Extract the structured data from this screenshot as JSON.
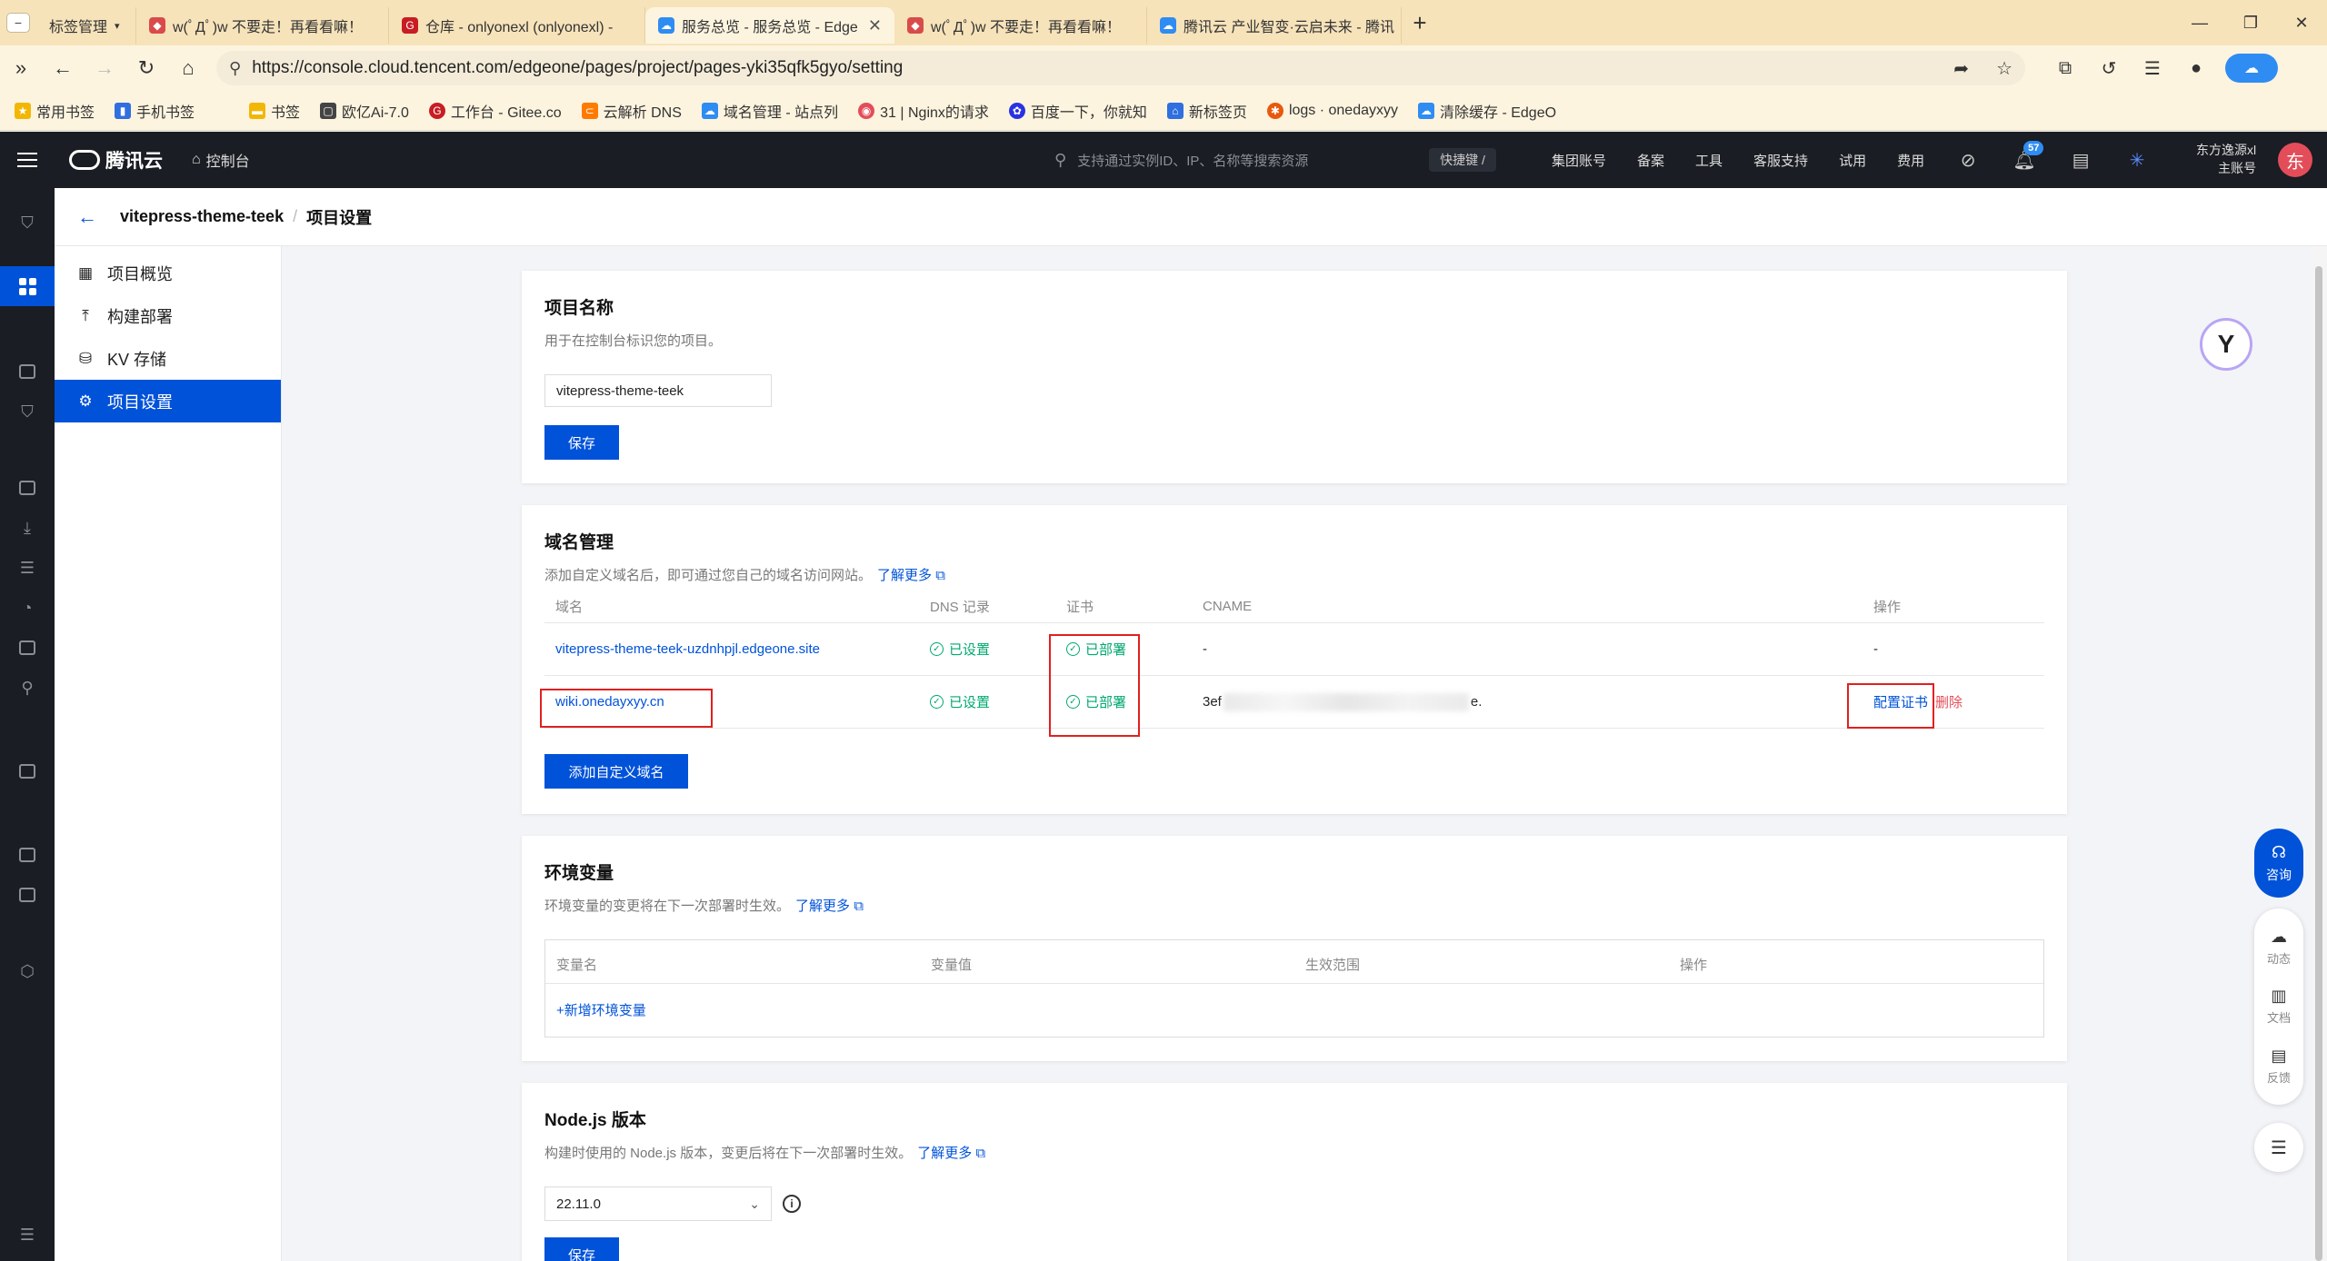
{
  "browser": {
    "tabs": [
      {
        "title": "标签管理",
        "color": "#555",
        "active": false
      },
      {
        "title": "w(ﾟДﾟ)w 不要走！再看看嘛！",
        "color": "#d94b4b",
        "active": false
      },
      {
        "title": "仓库 - onlyonexl (onlyonexl) - ",
        "color": "#c71d23",
        "active": false
      },
      {
        "title": "服务总览 - 服务总览 - EdgeO",
        "color": "#2f8cf2",
        "active": true
      },
      {
        "title": "w(ﾟДﾟ)w 不要走！再看看嘛！",
        "color": "#d94b4b",
        "active": false
      },
      {
        "title": "腾讯云 产业智变·云启未来 - 腾讯",
        "color": "#2f8cf2",
        "active": false
      }
    ],
    "url": "https://console.cloud.tencent.com/edgeone/pages/project/pages-yki35qfk5gyo/setting",
    "bookmarks": [
      {
        "label": "常用书签",
        "color": "#f2b705"
      },
      {
        "label": "手机书签",
        "color": "#2f6fe0"
      },
      {
        "label": "书签",
        "color": "#f2b705"
      },
      {
        "label": "欧亿Ai-7.0",
        "color": "#444"
      },
      {
        "label": "工作台 - Gitee.co",
        "color": "#c71d23"
      },
      {
        "label": "云解析 DNS",
        "color": "#ff7a00"
      },
      {
        "label": "域名管理 - 站点列",
        "color": "#2f8cf2"
      },
      {
        "label": "31 | Nginx的请求",
        "color": "#e34d59"
      },
      {
        "label": "百度一下，你就知",
        "color": "#2932e1"
      },
      {
        "label": "新标签页",
        "color": "#2f6fe0"
      },
      {
        "label": "logs · onedayxyy",
        "color": "#e8590c"
      },
      {
        "label": "清除缓存 - EdgeO",
        "color": "#2f8cf2"
      }
    ]
  },
  "topnav": {
    "brand": "腾讯云",
    "console": "控制台",
    "search_placeholder": "支持通过实例ID、IP、名称等搜索资源",
    "shortcut": "快捷键 /",
    "items": [
      "集团账号",
      "备案",
      "工具",
      "客服支持",
      "试用",
      "费用"
    ],
    "badge": "57",
    "account_name": "东方逸源xl",
    "account_role": "主账号",
    "avatar": "东"
  },
  "breadcrumb": {
    "project": "vitepress-theme-teek",
    "page": "项目设置"
  },
  "sidemenu": {
    "items": [
      {
        "label": "项目概览",
        "icon": "overview-icon",
        "active": false
      },
      {
        "label": "构建部署",
        "icon": "deploy-icon",
        "active": false
      },
      {
        "label": "KV 存储",
        "icon": "database-icon",
        "active": false
      },
      {
        "label": "项目设置",
        "icon": "settings-icon",
        "active": true
      }
    ]
  },
  "project_name": {
    "title": "项目名称",
    "desc": "用于在控制台标识您的项目。",
    "value": "vitepress-theme-teek",
    "save": "保存"
  },
  "domains": {
    "title": "域名管理",
    "desc": "添加自定义域名后，即可通过您自己的域名访问网站。",
    "learn_more": "了解更多",
    "headers": {
      "domain": "域名",
      "dns": "DNS 记录",
      "cert": "证书",
      "cname": "CNAME",
      "ops": "操作"
    },
    "rows": [
      {
        "domain": "vitepress-theme-teek-uzdnhpjl.edgeone.site",
        "dns": "已设置",
        "cert": "已部署",
        "cname_start": "-",
        "cname_end": "",
        "op1": "-",
        "op2": ""
      },
      {
        "domain": "wiki.onedayxyy.cn",
        "dns": "已设置",
        "cert": "已部署",
        "cname_start": "3ef",
        "cname_end": "e.",
        "op1": "配置证书",
        "op2": "删除"
      }
    ],
    "add": "添加自定义域名"
  },
  "env": {
    "title": "环境变量",
    "desc": "环境变量的变更将在下一次部署时生效。",
    "learn_more": "了解更多",
    "headers": {
      "name": "变量名",
      "value": "变量值",
      "scope": "生效范围",
      "ops": "操作"
    },
    "add": "+新增环境变量"
  },
  "node": {
    "title": "Node.js 版本",
    "desc": "构建时使用的 Node.js 版本，变更后将在下一次部署时生效。",
    "learn_more": "了解更多",
    "version": "22.11.0",
    "save": "保存"
  },
  "float": {
    "consult": "咨询",
    "tools": [
      {
        "label": "动态",
        "icon": "cloud-icon"
      },
      {
        "label": "文档",
        "icon": "book-icon"
      },
      {
        "label": "反馈",
        "icon": "feedback-icon"
      }
    ]
  }
}
